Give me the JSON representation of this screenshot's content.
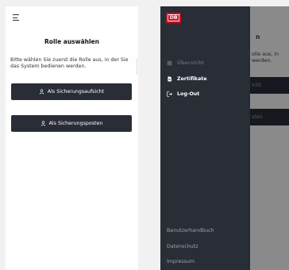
{
  "left_screen": {
    "title": "Rolle auswählen",
    "description": "Bitte wählen Sie zuerst die Rolle aus, in der Sie das System bedienen werden.",
    "buttons": [
      {
        "label": "Als Sicherungsaufsicht",
        "icon": "user-icon"
      },
      {
        "label": "Als Sicherungsposten",
        "icon": "user-icon"
      }
    ]
  },
  "right_screen": {
    "logo": "DB",
    "background": {
      "title_fragment": "n",
      "desc_line1": "olle aus, in",
      "desc_line2": "werden.",
      "button1_fragment": "icht",
      "button2_fragment": "sten"
    },
    "nav": [
      {
        "label": "Übersicht",
        "icon": "grid-icon",
        "disabled": true
      },
      {
        "label": "Zertifikate",
        "icon": "document-icon",
        "disabled": false
      },
      {
        "label": "Log-Out",
        "icon": "logout-icon",
        "disabled": false
      }
    ],
    "footer": [
      "Benutzerhandbuch",
      "Datenschutz",
      "Impressum"
    ]
  },
  "colors": {
    "dark": "#282d36",
    "brand_red": "#ec0016",
    "overlay": "#8a8a8a"
  }
}
